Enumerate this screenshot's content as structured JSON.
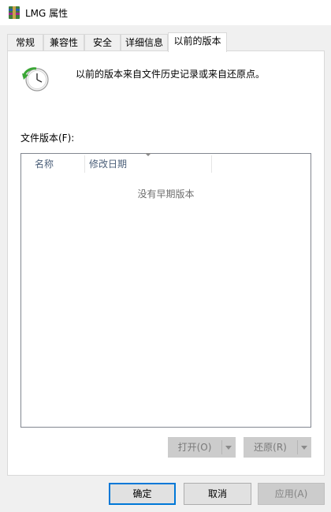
{
  "window": {
    "title": "LMG 属性",
    "icon": "winrar-archive-icon"
  },
  "tabs": [
    {
      "label": "常规",
      "active": false
    },
    {
      "label": "兼容性",
      "active": false
    },
    {
      "label": "安全",
      "active": false
    },
    {
      "label": "详细信息",
      "active": false
    },
    {
      "label": "以前的版本",
      "active": true
    }
  ],
  "previous_versions": {
    "icon": "restore-clock-icon",
    "description": "以前的版本来自文件历史记录或来自还原点。",
    "file_versions_label": "文件版本(F):",
    "columns": [
      "名称",
      "修改日期"
    ],
    "empty_message": "没有早期版本",
    "open_button": "打开(O)",
    "restore_button": "还原(R)"
  },
  "footer": {
    "ok": "确定",
    "cancel": "取消",
    "apply": "应用(A)"
  },
  "colors": {
    "accent": "#0078d7",
    "window_bg": "#f0f0f0",
    "panel_bg": "#ffffff",
    "disabled_bg": "#cccccc"
  }
}
